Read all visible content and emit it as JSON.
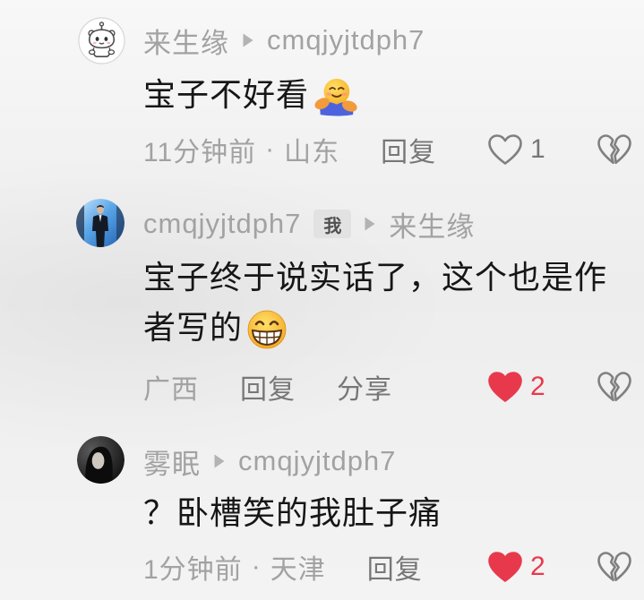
{
  "theme": {
    "background": "#ededed",
    "text_primary": "#161616",
    "text_secondary": "#a2a2a2",
    "text_action": "#777777",
    "like_red": "#e8394c",
    "icon_gray": "#808080"
  },
  "icons": {
    "reply_arrow": "reply-arrow-icon",
    "like": "heart-icon",
    "dislike": "broken-heart-icon"
  },
  "comments": [
    {
      "username": "来生缘",
      "reply_to": "cmqjyjtdph7",
      "content": "宝子不好看",
      "emoji_icon": "hugging-face-icon",
      "time": "11分钟前",
      "separator": "·",
      "location": "山东",
      "reply_label": "回复",
      "likes": "1",
      "liked": false
    },
    {
      "username": "cmqjyjtdph7",
      "badge": "我",
      "reply_to": "来生缘",
      "content": "宝子终于说实话了，这个也是作者写的",
      "emoji_icon": "grinning-face-icon",
      "location": "广西",
      "reply_label": "回复",
      "share_label": "分享",
      "likes": "2",
      "liked": true
    },
    {
      "username": "雾眠",
      "reply_to": "cmqjyjtdph7",
      "content": "？卧槽笑的我肚子痛",
      "time": "1分钟前",
      "separator": "·",
      "location": "天津",
      "reply_label": "回复",
      "likes": "2",
      "liked": true
    }
  ]
}
